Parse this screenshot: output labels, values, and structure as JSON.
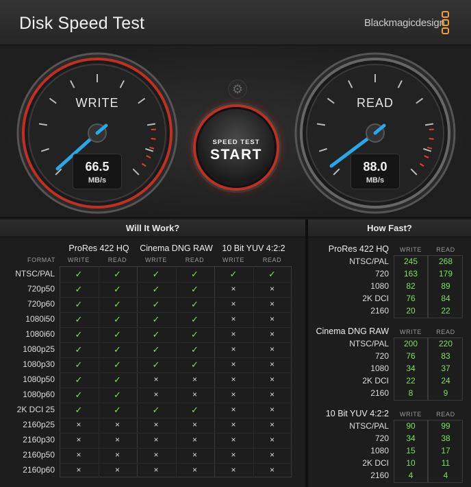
{
  "window": {
    "close_glyph": "×"
  },
  "header": {
    "title": "Disk Speed Test",
    "brand": "Blackmagicdesign"
  },
  "gauges": {
    "write": {
      "label": "WRITE",
      "value": "66.5",
      "unit": "MB/s"
    },
    "read": {
      "label": "READ",
      "value": "88.0",
      "unit": "MB/s"
    }
  },
  "start_button": {
    "line1": "SPEED TEST",
    "line2": "START"
  },
  "settings_icon": "gear-icon",
  "will_it_work": {
    "title": "Will It Work?",
    "format_header": "FORMAT",
    "groups": [
      "ProRes 422 HQ",
      "Cinema DNG RAW",
      "10 Bit YUV 4:2:2"
    ],
    "col_write": "WRITE",
    "col_read": "READ",
    "rows": [
      {
        "format": "NTSC/PAL",
        "marks": [
          1,
          1,
          1,
          1,
          1,
          1
        ]
      },
      {
        "format": "720p50",
        "marks": [
          1,
          1,
          1,
          1,
          0,
          0
        ]
      },
      {
        "format": "720p60",
        "marks": [
          1,
          1,
          1,
          1,
          0,
          0
        ]
      },
      {
        "format": "1080i50",
        "marks": [
          1,
          1,
          1,
          1,
          0,
          0
        ]
      },
      {
        "format": "1080i60",
        "marks": [
          1,
          1,
          1,
          1,
          0,
          0
        ]
      },
      {
        "format": "1080p25",
        "marks": [
          1,
          1,
          1,
          1,
          0,
          0
        ]
      },
      {
        "format": "1080p30",
        "marks": [
          1,
          1,
          1,
          1,
          0,
          0
        ]
      },
      {
        "format": "1080p50",
        "marks": [
          1,
          1,
          0,
          0,
          0,
          0
        ]
      },
      {
        "format": "1080p60",
        "marks": [
          1,
          1,
          0,
          0,
          0,
          0
        ]
      },
      {
        "format": "2K DCI 25",
        "marks": [
          1,
          1,
          1,
          1,
          0,
          0
        ]
      },
      {
        "format": "2160p25",
        "marks": [
          0,
          0,
          0,
          0,
          0,
          0
        ]
      },
      {
        "format": "2160p30",
        "marks": [
          0,
          0,
          0,
          0,
          0,
          0
        ]
      },
      {
        "format": "2160p50",
        "marks": [
          0,
          0,
          0,
          0,
          0,
          0
        ]
      },
      {
        "format": "2160p60",
        "marks": [
          0,
          0,
          0,
          0,
          0,
          0
        ]
      }
    ],
    "ok_glyph": "✓",
    "no_glyph": "×"
  },
  "how_fast": {
    "title": "How Fast?",
    "col_write": "WRITE",
    "col_read": "READ",
    "groups": [
      {
        "name": "ProRes 422 HQ",
        "rows": [
          {
            "label": "NTSC/PAL",
            "write": "245",
            "read": "268"
          },
          {
            "label": "720",
            "write": "163",
            "read": "179"
          },
          {
            "label": "1080",
            "write": "82",
            "read": "89"
          },
          {
            "label": "2K DCI",
            "write": "76",
            "read": "84"
          },
          {
            "label": "2160",
            "write": "20",
            "read": "22"
          }
        ]
      },
      {
        "name": "Cinema DNG RAW",
        "rows": [
          {
            "label": "NTSC/PAL",
            "write": "200",
            "read": "220"
          },
          {
            "label": "720",
            "write": "76",
            "read": "83"
          },
          {
            "label": "1080",
            "write": "34",
            "read": "37"
          },
          {
            "label": "2K DCI",
            "write": "22",
            "read": "24"
          },
          {
            "label": "2160",
            "write": "8",
            "read": "9"
          }
        ]
      },
      {
        "name": "10 Bit YUV 4:2:2",
        "rows": [
          {
            "label": "NTSC/PAL",
            "write": "90",
            "read": "99"
          },
          {
            "label": "720",
            "write": "34",
            "read": "38"
          },
          {
            "label": "1080",
            "write": "15",
            "read": "17"
          },
          {
            "label": "2K DCI",
            "write": "10",
            "read": "11"
          },
          {
            "label": "2160",
            "write": "4",
            "read": "4"
          }
        ]
      }
    ]
  },
  "colors": {
    "accent_green": "#7ee05a",
    "needle_blue": "#28a8e8",
    "ring_red": "#c03020",
    "brand_orange": "#f0a030"
  }
}
